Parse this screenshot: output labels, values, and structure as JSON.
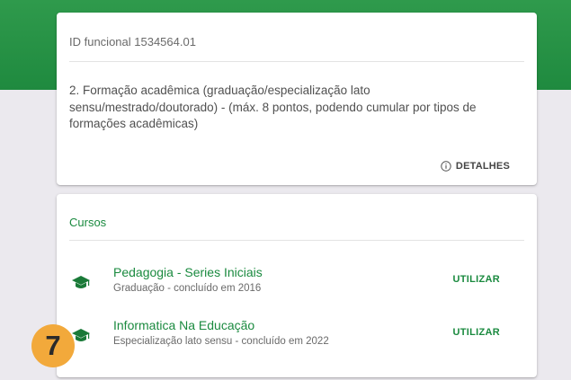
{
  "profile": {
    "id_line": "ID funcional 1534564.01",
    "question": "2. Formação acadêmica (graduação/especialização lato sensu/mestrado/doutorado) - (máx. 8 pontos, podendo cumular por tipos de formações acadêmicas)",
    "details_label": "DETALHES",
    "details_icon": "info-icon"
  },
  "courses": {
    "title": "Cursos",
    "items": [
      {
        "title": "Pedagogia - Series Iniciais",
        "subtitle": "Graduação - concluído em 2016",
        "action_label": "UTILIZAR",
        "icon": "graduation-cap-icon"
      },
      {
        "title": "Informatica Na Educação",
        "subtitle": "Especialização lato sensu - concluído em 2022",
        "action_label": "UTILIZAR",
        "icon": "graduation-cap-icon"
      }
    ]
  },
  "step_badge": "7",
  "colors": {
    "brand_green": "#1a8a3f",
    "header_green": "#2f9a4c",
    "badge_orange": "#f2a93b",
    "background": "#ebe9ee"
  }
}
